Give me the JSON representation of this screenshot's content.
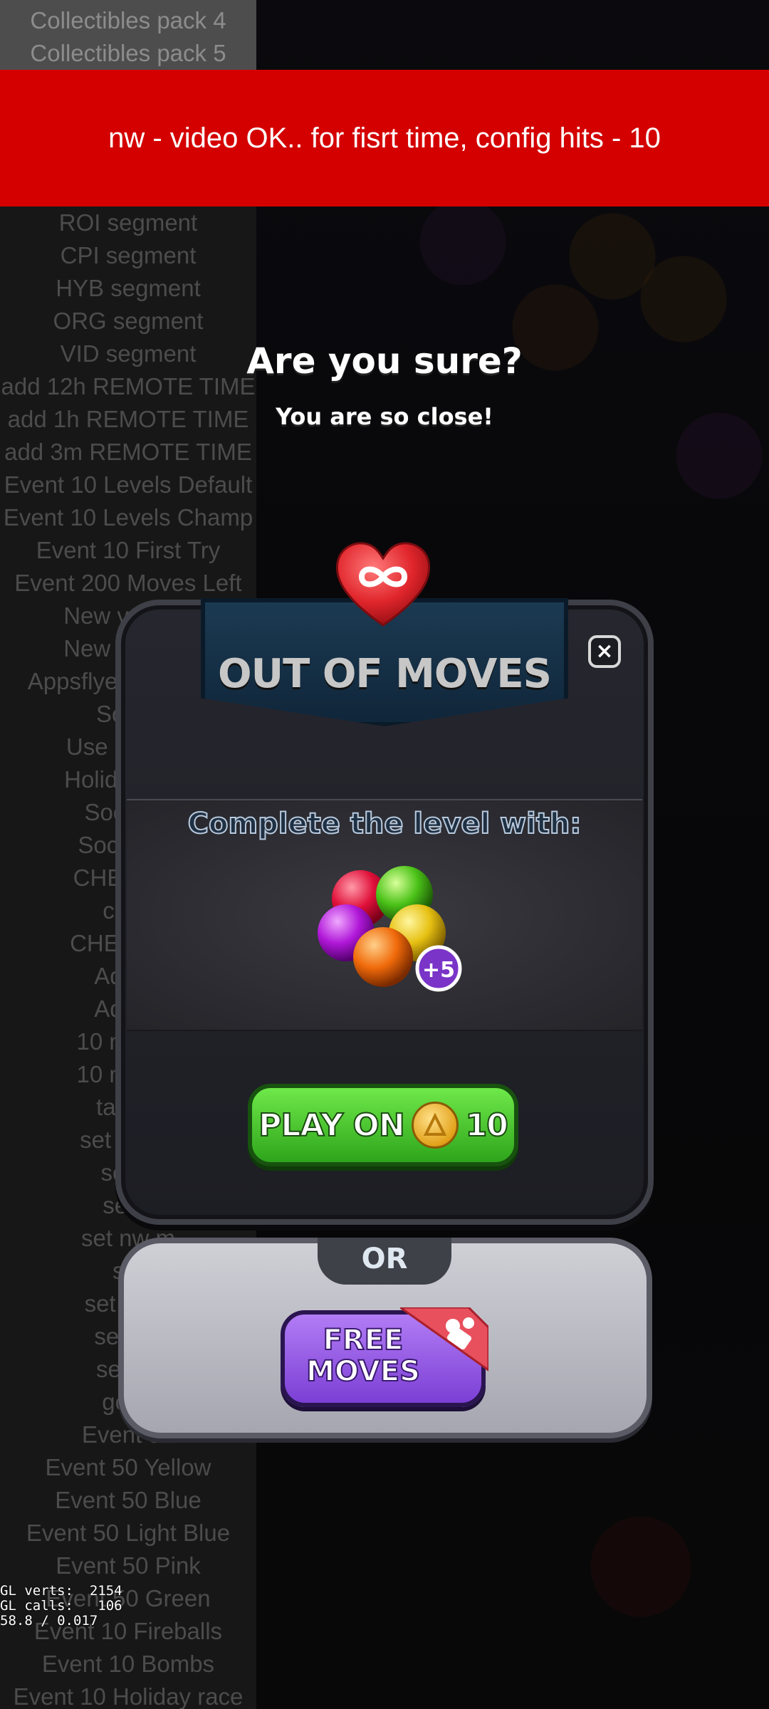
{
  "debug_menu": {
    "top_items": [
      "Collectibles pack 4",
      "Collectibles pack 5"
    ],
    "items": [
      "ROI segment",
      "CPI segment",
      "HYB segment",
      "ORG segment",
      "VID segment",
      "add 12h REMOTE TIME",
      "add 1h REMOTE TIME",
      "add 3m REMOTE TIME",
      "Event 10 Levels Default",
      "Event 10 Levels Champ",
      "Event 10 First Try",
      "Event 200 Moves Left",
      "New version",
      "New version",
      "Appsflyer purchase",
      "Social",
      "Use second",
      "Holiday sale",
      "Social R",
      "Social Re",
      "CHEAT 10",
      "clear",
      "CHEAT SH",
      "Add fa",
      "Add fa",
      "10 minute",
      "10 minute",
      "take a",
      "set super",
      "set w",
      "set n",
      "set nw m",
      "set",
      "set mid l",
      "set loc",
      "set ne",
      "get o",
      "Event 50",
      "Event 50 Yellow",
      "Event 50 Blue",
      "Event 50 Light Blue",
      "Event 50 Pink",
      "Event 50 Green",
      "Event 10 Fireballs",
      "Event 10 Bombs",
      "Event 10 Holiday race"
    ]
  },
  "toast": {
    "message": "nw - video OK.. for fisrt time, config hits - 10"
  },
  "dialog": {
    "title": "Are you sure?",
    "subtitle": "You are so close!",
    "banner": "OUT OF MOVES",
    "close_label": "×",
    "complete_text": "Complete the level with:",
    "bonus_label": "+5",
    "play_on": {
      "label": "PLAY ON",
      "cost": "10"
    },
    "or_label": "OR",
    "free_moves": {
      "line1": "FREE",
      "line2": "MOVES"
    }
  },
  "gl_stats": {
    "verts": "GL verts:  2154",
    "calls": "GL calls:   106",
    "fps": "58.8 / 0.017"
  },
  "colors": {
    "toast_red": "#d40000",
    "play_green": "#3cc423",
    "free_purple": "#9b5ce8",
    "heart_red": "#e0262c"
  },
  "icons": [
    "infinity-heart-icon",
    "close-icon",
    "coin-icon",
    "video-camera-icon",
    "bubbles-icon"
  ]
}
